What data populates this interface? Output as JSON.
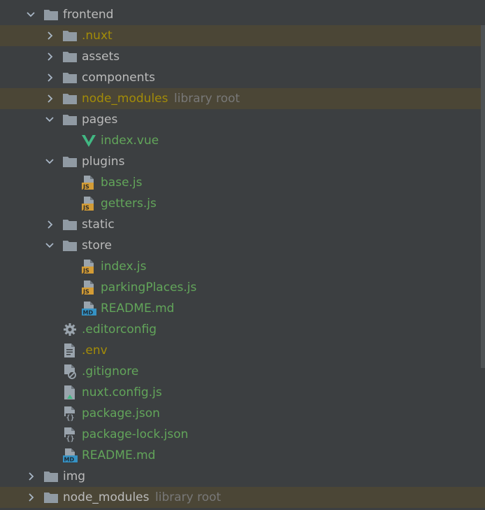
{
  "colors": {
    "background": "#3c3f41",
    "highlight": "#4b4636",
    "default_text": "#bbbbbb",
    "green_text": "#62a55a",
    "gold_text": "#a38c08",
    "suffix_text": "#787878",
    "folder": "#909aa3",
    "js_badge": "#d39c36",
    "md_badge": "#3592c4",
    "vue": "#41b883"
  },
  "tree": [
    {
      "label": "frontend",
      "icon": "folder-icon",
      "chevron": "chevron-down-icon",
      "color": "default",
      "suffix": ""
    },
    {
      "label": ".nuxt",
      "icon": "folder-icon",
      "chevron": "chevron-right-icon",
      "color": "gold",
      "suffix": ""
    },
    {
      "label": "assets",
      "icon": "folder-icon",
      "chevron": "chevron-right-icon",
      "color": "default",
      "suffix": ""
    },
    {
      "label": "components",
      "icon": "folder-icon",
      "chevron": "chevron-right-icon",
      "color": "default",
      "suffix": ""
    },
    {
      "label": "node_modules",
      "icon": "folder-icon",
      "chevron": "chevron-right-icon",
      "color": "gold",
      "suffix": "library root"
    },
    {
      "label": "pages",
      "icon": "folder-icon",
      "chevron": "chevron-down-icon",
      "color": "default",
      "suffix": ""
    },
    {
      "label": "index.vue",
      "icon": "vue-file-icon",
      "chevron": "",
      "color": "green",
      "suffix": ""
    },
    {
      "label": "plugins",
      "icon": "folder-icon",
      "chevron": "chevron-down-icon",
      "color": "default",
      "suffix": ""
    },
    {
      "label": "base.js",
      "icon": "js-file-icon",
      "chevron": "",
      "color": "green",
      "suffix": ""
    },
    {
      "label": "getters.js",
      "icon": "js-file-icon",
      "chevron": "",
      "color": "green",
      "suffix": ""
    },
    {
      "label": "static",
      "icon": "folder-icon",
      "chevron": "chevron-right-icon",
      "color": "default",
      "suffix": ""
    },
    {
      "label": "store",
      "icon": "folder-icon",
      "chevron": "chevron-down-icon",
      "color": "default",
      "suffix": ""
    },
    {
      "label": "index.js",
      "icon": "js-file-icon",
      "chevron": "",
      "color": "green",
      "suffix": ""
    },
    {
      "label": "parkingPlaces.js",
      "icon": "js-file-icon",
      "chevron": "",
      "color": "green",
      "suffix": ""
    },
    {
      "label": "README.md",
      "icon": "md-file-icon",
      "chevron": "",
      "color": "green",
      "suffix": ""
    },
    {
      "label": ".editorconfig",
      "icon": "gear-icon",
      "chevron": "",
      "color": "green",
      "suffix": ""
    },
    {
      "label": ".env",
      "icon": "text-file-icon",
      "chevron": "",
      "color": "gold",
      "suffix": ""
    },
    {
      "label": ".gitignore",
      "icon": "ignore-file-icon",
      "chevron": "",
      "color": "green",
      "suffix": ""
    },
    {
      "label": "nuxt.config.js",
      "icon": "nuxt-config-icon",
      "chevron": "",
      "color": "green",
      "suffix": ""
    },
    {
      "label": "package.json",
      "icon": "json-file-icon",
      "chevron": "",
      "color": "green",
      "suffix": ""
    },
    {
      "label": "package-lock.json",
      "icon": "json-file-icon",
      "chevron": "",
      "color": "green",
      "suffix": ""
    },
    {
      "label": "README.md",
      "icon": "md-file-icon",
      "chevron": "",
      "color": "green",
      "suffix": ""
    },
    {
      "label": "img",
      "icon": "folder-icon",
      "chevron": "chevron-right-icon",
      "color": "default",
      "suffix": ""
    },
    {
      "label": "node_modules",
      "icon": "folder-icon",
      "chevron": "chevron-right-icon",
      "color": "default",
      "suffix": "library root"
    }
  ]
}
